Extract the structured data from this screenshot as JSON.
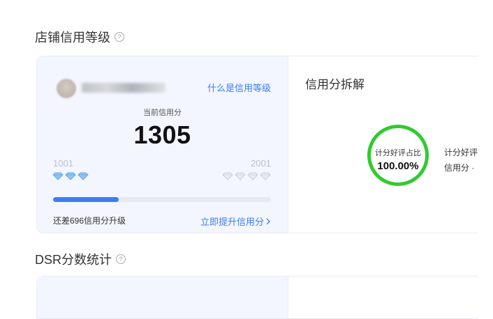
{
  "sections": {
    "credit_level_title": "店铺信用等级",
    "dsr_title": "DSR分数统计"
  },
  "credit": {
    "what_link": "什么是信用等级",
    "current_label": "当前信用分",
    "score": "1305",
    "level_low": "1001",
    "level_high": "2001",
    "progress_fraction": 0.3,
    "gap_text": "还差696信用分升级",
    "boost_link": "立即提升信用分"
  },
  "breakdown": {
    "title": "信用分拆解",
    "ring_label": "计分好评占比",
    "ring_value": "100.00%",
    "side_label_1": "计分好评",
    "side_label_2": "信用分 ·"
  },
  "colors": {
    "accent": "#3d7df2",
    "ring": "#2fcb2f",
    "card_bg": "#f3f6ff"
  }
}
